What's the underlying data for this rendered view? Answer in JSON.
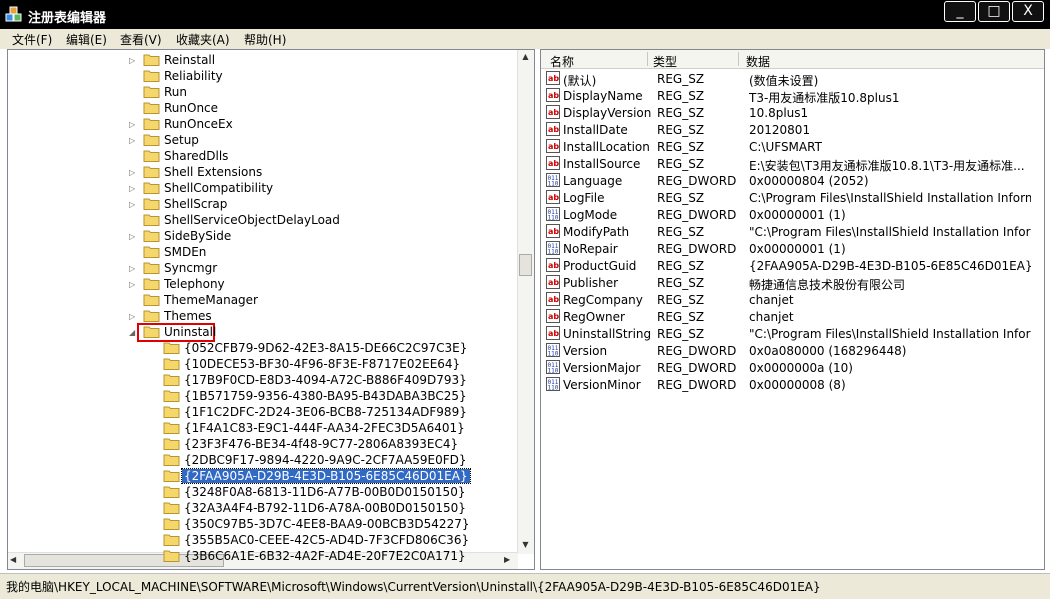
{
  "window": {
    "title": "注册表编辑器",
    "buttons": [
      "_",
      "□",
      "X"
    ]
  },
  "menu": [
    "文件(F)",
    "编辑(E)",
    "查看(V)",
    "收藏夹(A)",
    "帮助(H)"
  ],
  "tree": {
    "items": [
      {
        "label": "Reinstall",
        "expander": true
      },
      {
        "label": "Reliability",
        "expander": false
      },
      {
        "label": "Run",
        "expander": false
      },
      {
        "label": "RunOnce",
        "expander": false
      },
      {
        "label": "RunOnceEx",
        "expander": true
      },
      {
        "label": "Setup",
        "expander": true
      },
      {
        "label": "SharedDlls",
        "expander": false
      },
      {
        "label": "Shell Extensions",
        "expander": true
      },
      {
        "label": "ShellCompatibility",
        "expander": true
      },
      {
        "label": "ShellScrap",
        "expander": true
      },
      {
        "label": "ShellServiceObjectDelayLoad",
        "expander": false
      },
      {
        "label": "SideBySide",
        "expander": true
      },
      {
        "label": "SMDEn",
        "expander": false
      },
      {
        "label": "Syncmgr",
        "expander": true
      },
      {
        "label": "Telephony",
        "expander": true
      },
      {
        "label": "ThemeManager",
        "expander": false
      },
      {
        "label": "Themes",
        "expander": true
      },
      {
        "label": "Uninstall",
        "expander": true,
        "expanded": true
      }
    ],
    "children": [
      "{052CFB79-9D62-42E3-8A15-DE66C2C97C3E}",
      "{10DECE53-BF30-4F96-8F3E-F8717E02EE64}",
      "{17B9F0CD-E8D3-4094-A72C-B886F409D793}",
      "{1B571759-9356-4380-BA95-B43DABA3BC25}",
      "{1F1C2DFC-2D24-3E06-BCB8-725134ADF989}",
      "{1F4A1C83-E9C1-444F-AA34-2FEC3D5A6401}",
      "{23F3F476-BE34-4f48-9C77-2806A8393EC4}",
      "{2DBC9F17-9894-4220-9A9C-2CF7AA59E0FD}",
      "{2FAA905A-D29B-4E3D-B105-6E85C46D01EA}",
      "{3248F0A8-6813-11D6-A77B-00B0D0150150}",
      "{32A3A4F4-B792-11D6-A78A-00B0D0150150}",
      "{350C97B5-3D7C-4EE8-BAA9-00BCB3D54227}",
      "{355B5AC0-CEEE-42C5-AD4D-7F3CFD806C36}",
      "{3B6C6A1E-6B32-4A2F-AD4E-20F7E2C0A171}"
    ],
    "selected": "{2FAA905A-D29B-4E3D-B105-6E85C46D01EA}"
  },
  "list": {
    "columns": [
      "名称",
      "类型",
      "数据"
    ],
    "rows": [
      {
        "name": "(默认)",
        "type": "REG_SZ",
        "data": "(数值未设置)",
        "icon": "string-value-icon"
      },
      {
        "name": "DisplayName",
        "type": "REG_SZ",
        "data": "T3-用友通标准版10.8plus1",
        "icon": "string-value-icon"
      },
      {
        "name": "DisplayVersion",
        "type": "REG_SZ",
        "data": "10.8plus1",
        "icon": "string-value-icon"
      },
      {
        "name": "InstallDate",
        "type": "REG_SZ",
        "data": "20120801",
        "icon": "string-value-icon"
      },
      {
        "name": "InstallLocation",
        "type": "REG_SZ",
        "data": "C:\\UFSMART",
        "icon": "string-value-icon"
      },
      {
        "name": "InstallSource",
        "type": "REG_SZ",
        "data": "E:\\安装包\\T3用友通标准版10.8.1\\T3-用友通标准...",
        "icon": "string-value-icon"
      },
      {
        "name": "Language",
        "type": "REG_DWORD",
        "data": "0x00000804 (2052)",
        "icon": "binary-value-icon"
      },
      {
        "name": "LogFile",
        "type": "REG_SZ",
        "data": "C:\\Program Files\\InstallShield Installation Informa...",
        "icon": "string-value-icon"
      },
      {
        "name": "LogMode",
        "type": "REG_DWORD",
        "data": "0x00000001 (1)",
        "icon": "binary-value-icon"
      },
      {
        "name": "ModifyPath",
        "type": "REG_SZ",
        "data": "\"C:\\Program Files\\InstallShield Installation Inform...",
        "icon": "string-value-icon"
      },
      {
        "name": "NoRepair",
        "type": "REG_DWORD",
        "data": "0x00000001 (1)",
        "icon": "binary-value-icon"
      },
      {
        "name": "ProductGuid",
        "type": "REG_SZ",
        "data": "{2FAA905A-D29B-4E3D-B105-6E85C46D01EA}",
        "icon": "string-value-icon"
      },
      {
        "name": "Publisher",
        "type": "REG_SZ",
        "data": "畅捷通信息技术股份有限公司",
        "icon": "string-value-icon"
      },
      {
        "name": "RegCompany",
        "type": "REG_SZ",
        "data": "chanjet",
        "icon": "string-value-icon"
      },
      {
        "name": "RegOwner",
        "type": "REG_SZ",
        "data": "chanjet",
        "icon": "string-value-icon"
      },
      {
        "name": "UninstallString",
        "type": "REG_SZ",
        "data": "\"C:\\Program Files\\InstallShield Installation Inform...",
        "icon": "string-value-icon"
      },
      {
        "name": "Version",
        "type": "REG_DWORD",
        "data": "0x0a080000 (168296448)",
        "icon": "binary-value-icon"
      },
      {
        "name": "VersionMajor",
        "type": "REG_DWORD",
        "data": "0x0000000a (10)",
        "icon": "binary-value-icon"
      },
      {
        "name": "VersionMinor",
        "type": "REG_DWORD",
        "data": "0x00000008 (8)",
        "icon": "binary-value-icon"
      }
    ]
  },
  "status": "我的电脑\\HKEY_LOCAL_MACHINE\\SOFTWARE\\Microsoft\\Windows\\CurrentVersion\\Uninstall\\{2FAA905A-D29B-4E3D-B105-6E85C46D01EA}"
}
